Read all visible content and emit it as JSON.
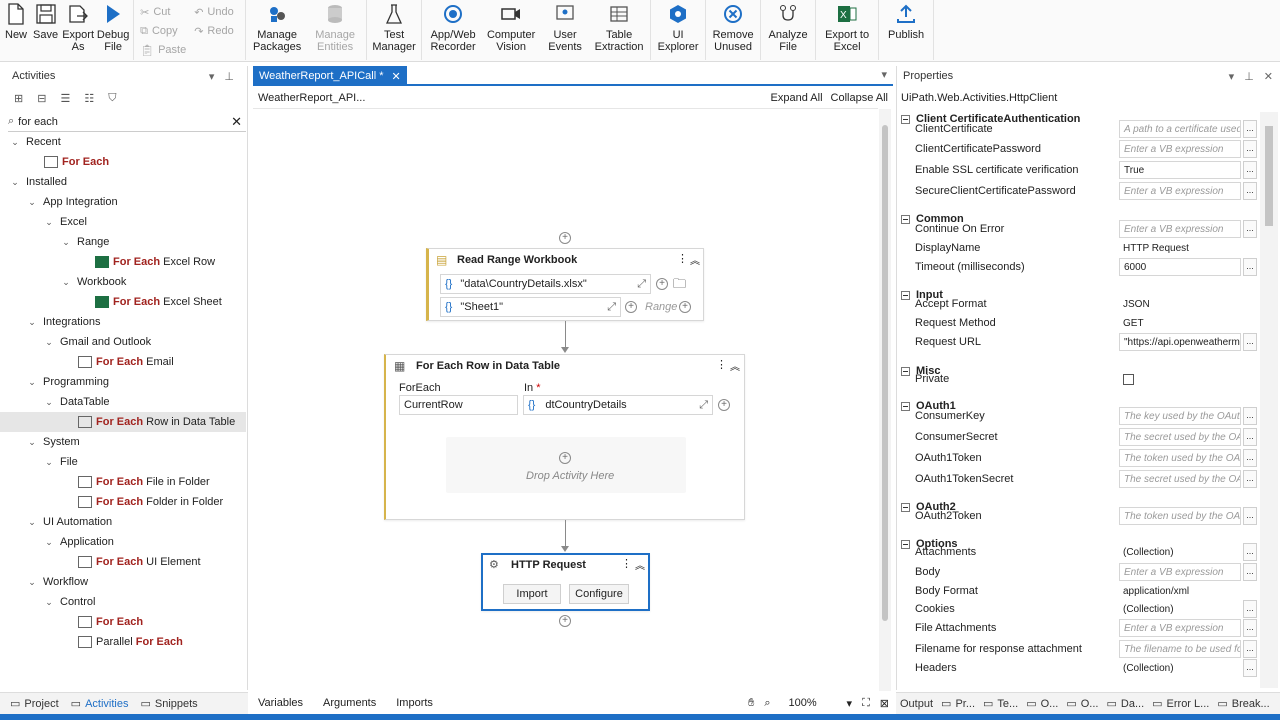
{
  "ribbon": {
    "file_group": [
      {
        "label": "New",
        "icon": "new-file-icon"
      },
      {
        "label": "Save",
        "icon": "save-icon"
      },
      {
        "label": "Export As",
        "icon": "export-icon"
      },
      {
        "label": "Debug File",
        "icon": "play-icon"
      }
    ],
    "edit_items": [
      {
        "label": "Cut",
        "icon": "cut-icon"
      },
      {
        "label": "Undo",
        "icon": "undo-icon"
      },
      {
        "label": "Copy",
        "icon": "copy-icon"
      },
      {
        "label": "Redo",
        "icon": "redo-icon"
      },
      {
        "label": "Paste",
        "icon": "paste-icon"
      }
    ],
    "buttons": [
      {
        "label": "Manage Packages",
        "icon": "packages-icon",
        "disabled": false
      },
      {
        "label": "Manage Entities",
        "icon": "database-icon",
        "disabled": true
      },
      {
        "label": "Test Manager",
        "icon": "flask-icon",
        "disabled": false
      },
      {
        "label": "App/Web Recorder",
        "icon": "record-icon",
        "disabled": false
      },
      {
        "label": "Computer Vision",
        "icon": "camera-icon",
        "disabled": false
      },
      {
        "label": "User Events",
        "icon": "user-events-icon",
        "disabled": false
      },
      {
        "label": "Table Extraction",
        "icon": "table-icon",
        "disabled": false
      },
      {
        "label": "UI Explorer",
        "icon": "ui-explorer-icon",
        "disabled": false
      },
      {
        "label": "Remove Unused",
        "icon": "remove-icon",
        "disabled": false
      },
      {
        "label": "Analyze File",
        "icon": "analyze-icon",
        "disabled": false
      },
      {
        "label": "Export to Excel",
        "icon": "excel-icon",
        "disabled": false
      },
      {
        "label": "Publish",
        "icon": "publish-icon",
        "disabled": false
      }
    ]
  },
  "activities": {
    "title": "Activities",
    "search_value": "for each",
    "tree": [
      {
        "label": "Recent",
        "level": 0,
        "expand": true
      },
      {
        "pre": "",
        "hl": "For Each",
        "post": "",
        "level": 2,
        "icon": "for-each-icon"
      },
      {
        "label": "Installed",
        "level": 0,
        "expand": true
      },
      {
        "label": "App Integration",
        "level": 1,
        "expand": true
      },
      {
        "label": "Excel",
        "level": 2,
        "expand": true
      },
      {
        "label": "Range",
        "level": 3,
        "expand": true
      },
      {
        "pre": "",
        "hl": "For Each",
        "post": " Excel Row",
        "level": 5,
        "icon": "excel-icon"
      },
      {
        "label": "Workbook",
        "level": 3,
        "expand": true
      },
      {
        "pre": "",
        "hl": "For Each",
        "post": " Excel Sheet",
        "level": 5,
        "icon": "excel-icon"
      },
      {
        "label": "Integrations",
        "level": 1,
        "expand": true
      },
      {
        "label": "Gmail and Outlook",
        "level": 2,
        "expand": true
      },
      {
        "pre": "",
        "hl": "For Each",
        "post": " Email",
        "level": 4,
        "icon": "email-icon"
      },
      {
        "label": "Programming",
        "level": 1,
        "expand": true
      },
      {
        "label": "DataTable",
        "level": 2,
        "expand": true
      },
      {
        "pre": "",
        "hl": "For Each",
        "post": " Row in Data Table",
        "level": 4,
        "icon": "datatable-icon",
        "selected": true
      },
      {
        "label": "System",
        "level": 1,
        "expand": true
      },
      {
        "label": "File",
        "level": 2,
        "expand": true
      },
      {
        "pre": "",
        "hl": "For Each",
        "post": " File in Folder",
        "level": 4,
        "icon": "folder-icon"
      },
      {
        "pre": "",
        "hl": "For Each",
        "post": " Folder in Folder",
        "level": 4,
        "icon": "folder-icon"
      },
      {
        "label": "UI Automation",
        "level": 1,
        "expand": true
      },
      {
        "label": "Application",
        "level": 2,
        "expand": true
      },
      {
        "pre": "",
        "hl": "For Each",
        "post": " UI Element",
        "level": 4,
        "icon": "ui-element-icon"
      },
      {
        "label": "Workflow",
        "level": 1,
        "expand": true
      },
      {
        "label": "Control",
        "level": 2,
        "expand": true
      },
      {
        "pre": "",
        "hl": "For Each",
        "post": "",
        "level": 4,
        "icon": "for-each-icon"
      },
      {
        "pre": "Parallel ",
        "hl": "For Each",
        "post": "",
        "level": 4,
        "icon": "parallel-icon"
      }
    ],
    "bottom_tabs": [
      "Project",
      "Activities",
      "Snippets"
    ]
  },
  "designer": {
    "tab_label": "WeatherReport_APICall *",
    "breadcrumb": "WeatherReport_API...",
    "expand_all": "Expand All",
    "collapse_all": "Collapse All",
    "read_range": {
      "title": "Read Range Workbook",
      "path": "\"data\\CountryDetails.xlsx\"",
      "sheet": "\"Sheet1\"",
      "range_placeholder": "Range"
    },
    "for_each_row": {
      "title": "For Each Row in Data Table",
      "foreach_label": "ForEach",
      "in_label": "In",
      "required_mark": "*",
      "item": "CurrentRow",
      "in_value": "dtCountryDetails",
      "drop_text": "Drop Activity Here"
    },
    "http_request": {
      "title": "HTTP Request",
      "import_label": "Import",
      "configure_label": "Configure"
    },
    "bottom_tabs": [
      "Variables",
      "Arguments",
      "Imports"
    ],
    "zoom": "100%"
  },
  "properties": {
    "title": "Properties",
    "type_name": "UiPath.Web.Activities.HttpClient",
    "categories": [
      {
        "name": "Client CertificateAuthentication",
        "rows": [
          {
            "name": "ClientCertificate",
            "value": "A path to a certificate used",
            "ph": true,
            "dots": true
          },
          {
            "name": "ClientCertificatePassword",
            "value": "Enter a VB expression",
            "ph": true,
            "dots": true
          },
          {
            "name": "Enable SSL certificate verification",
            "value": "True",
            "ph": false,
            "dots": true
          },
          {
            "name": "SecureClientCertificatePassword",
            "value": "Enter a VB expression",
            "ph": true,
            "dots": true
          }
        ]
      },
      {
        "name": "Common",
        "rows": [
          {
            "name": "Continue On Error",
            "value": "Enter a VB expression",
            "ph": true,
            "dots": true
          },
          {
            "name": "DisplayName",
            "value": "HTTP Request",
            "ph": false,
            "dots": false,
            "plain": true
          },
          {
            "name": "Timeout (milliseconds)",
            "value": "6000",
            "ph": false,
            "dots": true
          }
        ]
      },
      {
        "name": "Input",
        "rows": [
          {
            "name": "Accept Format",
            "value": "JSON",
            "ph": false,
            "dots": false,
            "plain": true
          },
          {
            "name": "Request Method",
            "value": "GET",
            "ph": false,
            "dots": false,
            "plain": true
          },
          {
            "name": "Request URL",
            "value": "\"https://api.openweatherm",
            "ph": false,
            "dots": true
          }
        ]
      },
      {
        "name": "Misc",
        "rows": [
          {
            "name": "Private",
            "value": "",
            "checkbox": true
          }
        ]
      },
      {
        "name": "OAuth1",
        "rows": [
          {
            "name": "ConsumerKey",
            "value": "The key used by the OAuth",
            "ph": true,
            "dots": true
          },
          {
            "name": "ConsumerSecret",
            "value": "The secret used by the OA",
            "ph": true,
            "dots": true
          },
          {
            "name": "OAuth1Token",
            "value": "The token used by the OAu",
            "ph": true,
            "dots": true
          },
          {
            "name": "OAuth1TokenSecret",
            "value": "The secret used by the OA",
            "ph": true,
            "dots": true
          }
        ]
      },
      {
        "name": "OAuth2",
        "rows": [
          {
            "name": "OAuth2Token",
            "value": "The token used by the OAu",
            "ph": true,
            "dots": true
          }
        ]
      },
      {
        "name": "Options",
        "rows": [
          {
            "name": "Attachments",
            "value": "(Collection)",
            "ph": false,
            "dots": true,
            "plain": true
          },
          {
            "name": "Body",
            "value": "Enter a VB expression",
            "ph": true,
            "dots": true
          },
          {
            "name": "Body Format",
            "value": "application/xml",
            "ph": false,
            "dots": false,
            "plain": true
          },
          {
            "name": "Cookies",
            "value": "(Collection)",
            "ph": false,
            "dots": true,
            "plain": true
          },
          {
            "name": "File Attachments",
            "value": "Enter a VB expression",
            "ph": true,
            "dots": true
          },
          {
            "name": "Filename for response attachment",
            "value": "The filename to be used fo",
            "ph": true,
            "dots": true
          },
          {
            "name": "Headers",
            "value": "(Collection)",
            "ph": false,
            "dots": true,
            "plain": true
          }
        ]
      }
    ],
    "bottom_tabs": [
      "Output",
      "Pr...",
      "Te...",
      "O...",
      "O...",
      "Da...",
      "Error L...",
      "Break..."
    ]
  },
  "colors": {
    "accent": "#1e6fc6",
    "highlight": "#a1231f",
    "excel": "#1d6f42"
  }
}
